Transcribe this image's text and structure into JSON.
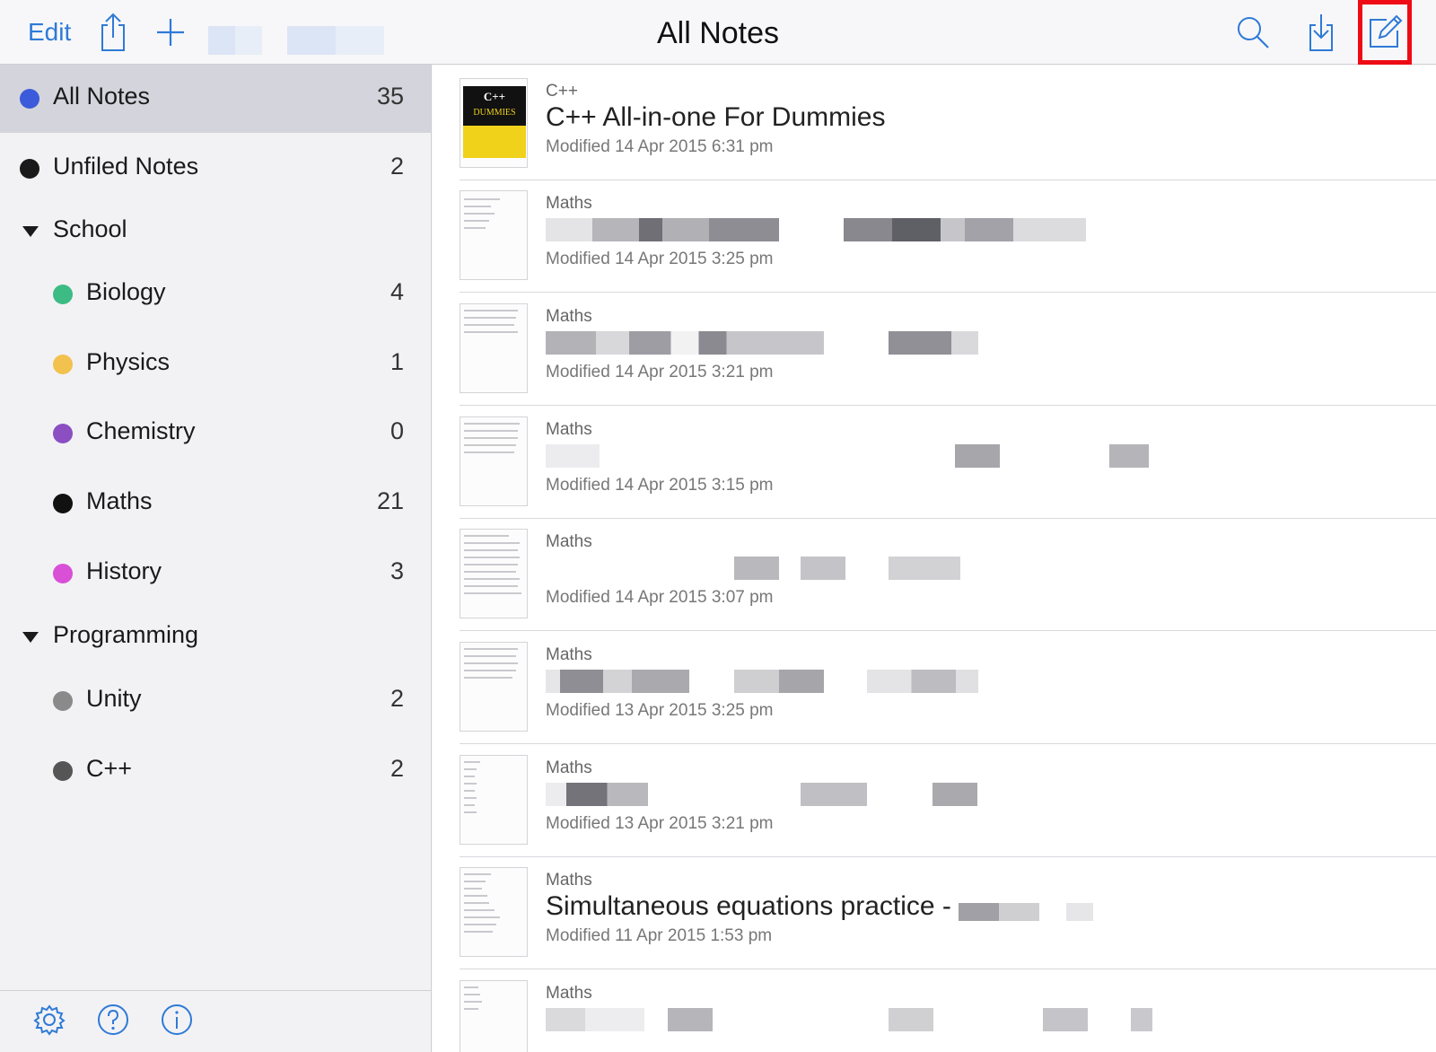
{
  "toolbar": {
    "edit_label": "Edit",
    "title": "All Notes",
    "accent_color": "#2f7ad6",
    "icons": [
      "share-icon",
      "add-icon",
      "search-icon",
      "download-icon",
      "compose-icon"
    ]
  },
  "sidebar": {
    "items": [
      {
        "label": "All Notes",
        "count": "35",
        "color": "#3b5bdb"
      },
      {
        "label": "Unfiled Notes",
        "count": "2",
        "color": "#1a1a1a"
      },
      {
        "label": "School",
        "count": ""
      },
      {
        "label": "Biology",
        "count": "4",
        "color": "#3dbb84"
      },
      {
        "label": "Physics",
        "count": "1",
        "color": "#f2c14e"
      },
      {
        "label": "Chemistry",
        "count": "0",
        "color": "#8b4fc2"
      },
      {
        "label": "Maths",
        "count": "21",
        "color": "#111111"
      },
      {
        "label": "History",
        "count": "3",
        "color": "#d94fd6"
      },
      {
        "label": "Programming",
        "count": ""
      },
      {
        "label": "Unity",
        "count": "2",
        "color": "#8a8a8a"
      },
      {
        "label": "C++",
        "count": "2",
        "color": "#555555"
      }
    ],
    "bottom_icons": [
      "settings-icon",
      "help-icon",
      "info-icon"
    ]
  },
  "notes": [
    {
      "notebook": "C++",
      "title": "C++ All-in-one For Dummies",
      "modified": "Modified 14 Apr 2015 6:31 pm",
      "cover_title": "C++",
      "cover_sub": "DUMMIES"
    },
    {
      "notebook": "Maths",
      "title": "",
      "modified": "Modified 14 Apr 2015 3:25 pm"
    },
    {
      "notebook": "Maths",
      "title": "",
      "modified": "Modified 14 Apr 2015 3:21 pm"
    },
    {
      "notebook": "Maths",
      "title": "",
      "modified": "Modified 14 Apr 2015 3:15 pm"
    },
    {
      "notebook": "Maths",
      "title": "",
      "modified": "Modified 14 Apr 2015 3:07 pm"
    },
    {
      "notebook": "Maths",
      "title": "",
      "modified": "Modified 13 Apr 2015 3:25 pm"
    },
    {
      "notebook": "Maths",
      "title": "",
      "modified": "Modified 13 Apr 2015 3:21 pm"
    },
    {
      "notebook": "Maths",
      "title": "Simultaneous equations practice -",
      "modified": "Modified 11 Apr 2015 1:53 pm"
    },
    {
      "notebook": "Maths",
      "title": "",
      "modified": ""
    }
  ]
}
